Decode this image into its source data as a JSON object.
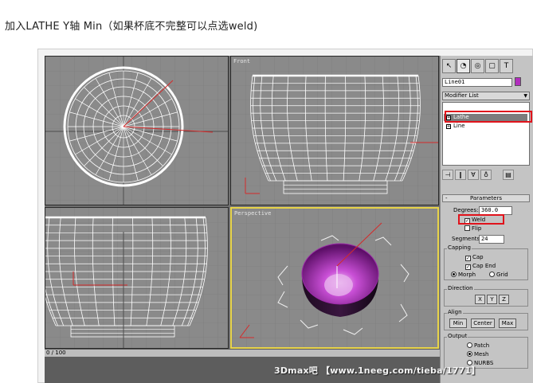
{
  "caption": "加入LATHE    Y轴    Min（如果杯底不完整可以点选weld)",
  "viewports": {
    "top_label": "",
    "front_label": "Front",
    "left_label": "",
    "perspective_label": "Perspective"
  },
  "timeline": {
    "text": "0 / 100"
  },
  "panel": {
    "tabs": [
      "↖",
      "◔",
      "◎",
      "▢",
      "T"
    ],
    "object_name": "Line01",
    "object_color": "#b12dbd",
    "modifier_list_label": "Modifier List",
    "stack": [
      {
        "label": "Lathe",
        "expander": "+"
      },
      {
        "label": "Line",
        "expander": "+"
      }
    ],
    "toolbar_icons": [
      "pin-icon",
      "show-end-result-icon",
      "make-unique-icon",
      "remove-modifier-icon",
      "configure-icon"
    ],
    "parameters": {
      "title": "Parameters",
      "degrees_label": "Degrees:",
      "degrees_value": "360.0",
      "weld_label": "Weld",
      "weld_checked": true,
      "flip_label": "Flip",
      "flip_checked": false,
      "segments_label": "Segments:",
      "segments_value": "24",
      "capping": {
        "title": "Capping",
        "cap_start": "Cap",
        "cap_end": "Cap End",
        "morph": "Morph",
        "grid": "Grid"
      },
      "direction": {
        "title": "Direction",
        "x": "X",
        "y": "Y",
        "z": "Z"
      },
      "align": {
        "title": "Align",
        "min": "Min",
        "center": "Center",
        "max": "Max"
      },
      "output": {
        "title": "Output",
        "patch": "Patch",
        "mesh": "Mesh",
        "nurbs": "NURBS"
      }
    }
  },
  "watermark": "3Dmax吧 【www.1neeg.com/tieba/1771】",
  "colors": {
    "viewport_bg": "#8a8a8a",
    "wire": "#ffffff",
    "highlight": "#e0131b",
    "active_border": "#e8d44a",
    "cup_purple": "#b12dbd"
  }
}
